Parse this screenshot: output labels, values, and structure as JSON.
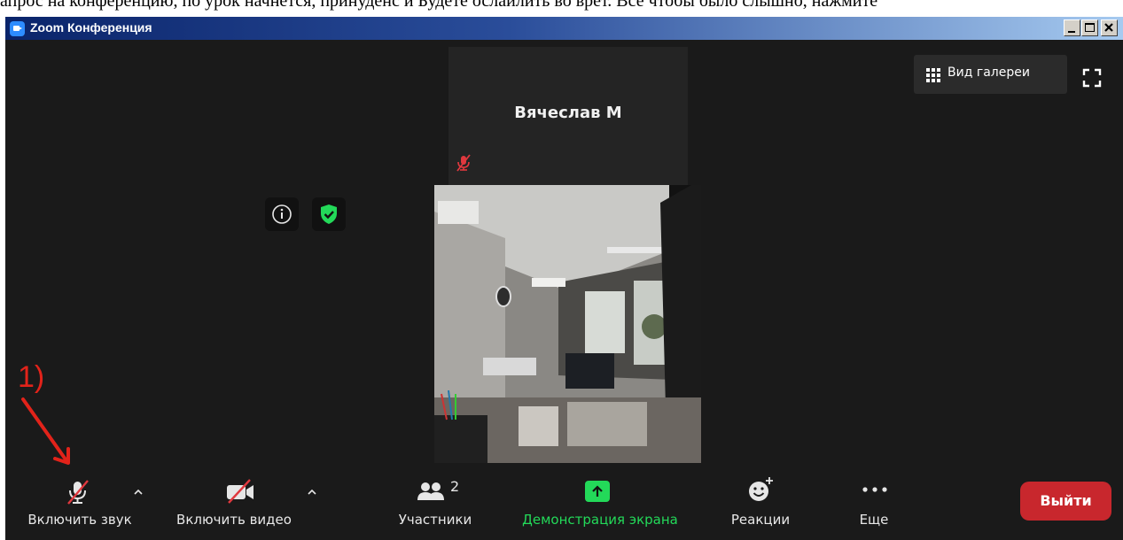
{
  "top_strip_text": "апрос на конференцию, по урок начнется, принуденс и Будете ослайлить во врет. Все чтобы было слышно, нажмите",
  "window": {
    "title": "Zoom Конференция",
    "controls": [
      "minimize",
      "maximize",
      "close"
    ]
  },
  "speaker": {
    "name": "Вячеслав М",
    "mic_icon": "mic-muted-icon"
  },
  "gallery": {
    "label": "Вид галереи",
    "icon": "grid-icon"
  },
  "status_icons": [
    "info-icon",
    "shield-check-icon"
  ],
  "colors": {
    "window_bg": "#1a1a1a",
    "tile_bg": "#242424",
    "accent_green": "#23d959",
    "leave_red": "#c8272d",
    "mute_red": "#e0383e",
    "annotation_red": "#e2231a"
  },
  "toolbar": {
    "audio": {
      "label": "Включить звук",
      "icon": "mic-muted-icon",
      "has_menu": true
    },
    "video": {
      "label": "Включить видео",
      "icon": "camera-off-icon",
      "has_menu": true
    },
    "participants": {
      "label": "Участники",
      "count": "2",
      "icon": "participants-icon"
    },
    "share": {
      "label": "Демонстрация экрана",
      "icon": "share-screen-icon"
    },
    "reactions": {
      "label": "Реакции",
      "icon": "emoji-add-icon"
    },
    "more": {
      "label": "Еще",
      "icon": "more-dots-icon"
    },
    "leave": {
      "label": "Выйти"
    }
  },
  "annotation": {
    "label": "1)"
  }
}
